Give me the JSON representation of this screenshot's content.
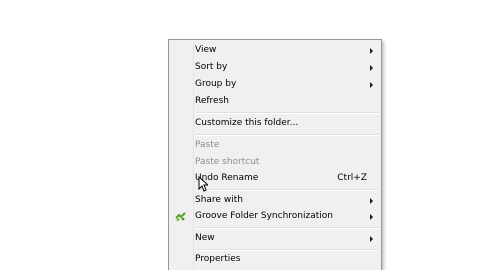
{
  "context_menu": {
    "items": [
      {
        "label": "View",
        "submenu": true
      },
      {
        "label": "Sort by",
        "submenu": true
      },
      {
        "label": "Group by",
        "submenu": true
      },
      {
        "label": "Refresh"
      },
      {
        "label": "Customize this folder..."
      },
      {
        "label": "Paste",
        "disabled": true
      },
      {
        "label": "Paste shortcut",
        "disabled": true
      },
      {
        "label": "Undo Rename",
        "shortcut": "Ctrl+Z"
      },
      {
        "label": "Share with",
        "submenu": true
      },
      {
        "label": "Groove Folder Synchronization",
        "submenu": true,
        "icon": "groove-sync-icon"
      },
      {
        "label": "New",
        "submenu": true
      },
      {
        "label": "Properties"
      }
    ]
  },
  "colors": {
    "menu_background": "#f0f0f0",
    "menu_border": "#979797",
    "disabled_text": "#8d8d8d",
    "groove_icon_green": "#5aa02c"
  }
}
